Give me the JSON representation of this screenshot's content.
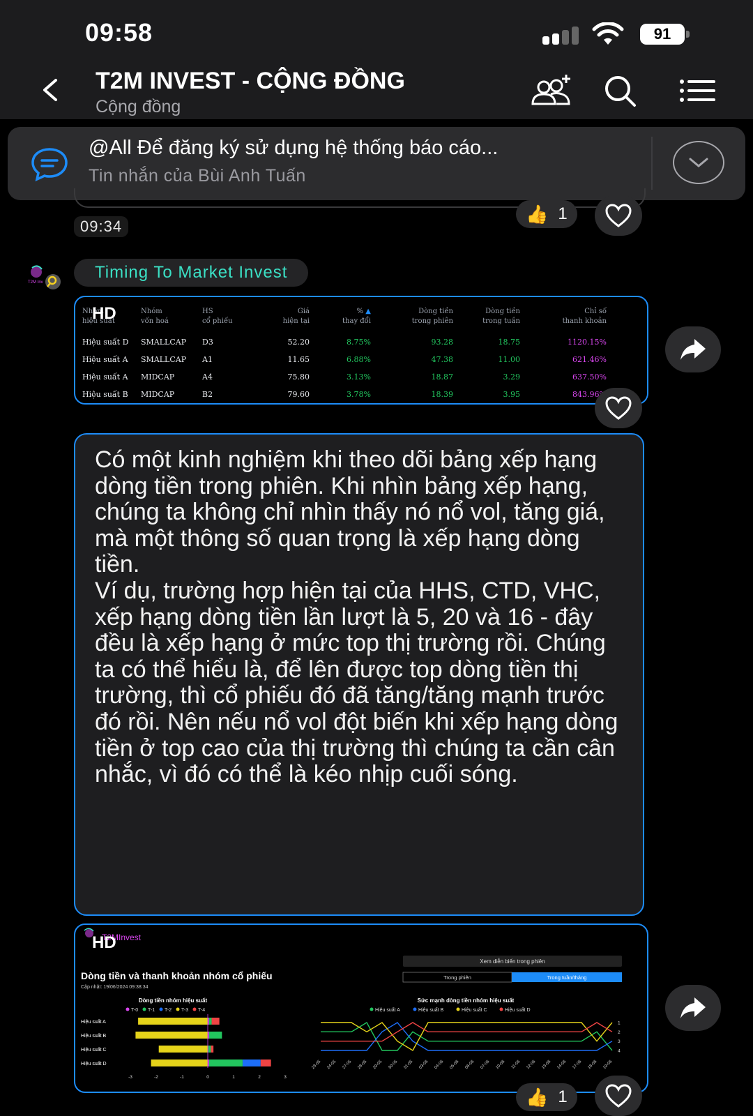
{
  "status_bar": {
    "time": "09:58",
    "battery": "91"
  },
  "header": {
    "title": "T2M INVEST - CỘNG ĐỒNG",
    "subtitle": "Cộng đồng"
  },
  "pinned": {
    "text": "@All Để đăng ký sử dụng hệ thống báo cáo...",
    "sender": "Tin nhắn của Bùi Anh Tuấn"
  },
  "messages": {
    "time_1": "09:34",
    "reaction_1": {
      "emoji": "thumbs-up",
      "count": "1"
    },
    "sender_name": "Timing To Market Invest",
    "hd_label": "HD",
    "table": {
      "headers": [
        [
          "Nhóm",
          "hiệu suất"
        ],
        [
          "Nhóm",
          "vốn hoá"
        ],
        [
          "HS",
          "cổ phiếu"
        ],
        [
          "Giá",
          "hiện tại"
        ],
        [
          "%",
          "thay đổi"
        ],
        [
          "Dòng tiền",
          "trong phiên"
        ],
        [
          "Dòng tiền",
          "trong tuần"
        ],
        [
          "Chỉ số",
          "thanh khoản"
        ]
      ],
      "rows": [
        [
          "Hiệu suất D",
          "SMALLCAP",
          "D3",
          "52.20",
          "8.75%",
          "93.28",
          "18.75",
          "1120.15%"
        ],
        [
          "Hiệu suất A",
          "SMALLCAP",
          "A1",
          "11.65",
          "6.88%",
          "47.38",
          "11.00",
          "621.46%"
        ],
        [
          "Hiệu suất A",
          "MIDCAP",
          "A4",
          "75.80",
          "3.13%",
          "18.87",
          "3.29",
          "637.50%"
        ],
        [
          "Hiệu suất B",
          "MIDCAP",
          "B2",
          "79.60",
          "3.78%",
          "18.39",
          "3.95",
          "843.96%"
        ]
      ]
    },
    "text_body": "Có một kinh nghiệm khi theo dõi bảng xếp hạng dòng tiền trong phiên. Khi nhìn bảng xếp hạng, chúng ta không chỉ nhìn thấy nó nổ vol, tăng giá, mà một thông số quan trọng là xếp hạng dòng tiền.\nVí dụ, trường hợp hiện tại của HHS, CTD, VHC, xếp hạng dòng tiền lần lượt là 5, 20 và 16 - đây đều là xếp hạng ở mức top thị trường rồi. Chúng ta có thể hiểu là, để lên được top dòng tiền thị trường, thì cổ phiếu đó đã tăng/tăng mạnh trước đó rồi. Nên nếu nổ vol đột biến khi xếp hạng dòng tiền ở top cao của thị trường thì chúng ta cần cân nhắc, vì đó có thể là kéo nhịp cuối sóng.",
    "reaction_2": {
      "emoji": "thumbs-up",
      "count": "1"
    }
  },
  "chart_image": {
    "brand": "T2MInvest",
    "title": "Dòng tiền và thanh khoản nhóm cổ phiếu",
    "updated": "Cập nhật: 19/06/2024 09:38:34",
    "toggle_label": "Xem diễn biến trong phiên",
    "tab_1": "Trong phiên",
    "tab_2": "Trong tuần/tháng",
    "colors": {
      "accent": "#1d8cf8",
      "teal": "#3be0c5"
    },
    "chart_data": [
      {
        "type": "bar",
        "title": "Dòng tiền nhóm hiệu suất",
        "categories": [
          "Hiệu suất A",
          "Hiệu suất B",
          "Hiệu suất C",
          "Hiệu suất D"
        ],
        "xlim": [
          -3,
          3
        ],
        "x_ticks": [
          "-3",
          "-2",
          "-1",
          "0",
          "1",
          "2",
          "3"
        ],
        "series": [
          {
            "name": "T-0",
            "color": "#d946ef",
            "values": [
              0.05,
              0.05,
              0.02,
              0.05
            ]
          },
          {
            "name": "T-1",
            "color": "#22c55e",
            "values": [
              0.1,
              0.5,
              0.1,
              1.3
            ]
          },
          {
            "name": "T-2",
            "color": "#1d6ef8",
            "values": [
              0.0,
              0.0,
              0.0,
              0.7
            ]
          },
          {
            "name": "T-3",
            "color": "#e5d31a",
            "values": [
              -2.7,
              -2.8,
              -1.9,
              -2.2
            ]
          },
          {
            "name": "T-4",
            "color": "#ef4444",
            "values": [
              0.3,
              0.0,
              0.1,
              0.4
            ]
          }
        ]
      },
      {
        "type": "line",
        "title": "Sức mạnh dòng tiền nhóm hiệu suất",
        "x": [
          "23-05",
          "24-05",
          "27-05",
          "28-05",
          "29-05",
          "30-05",
          "31-05",
          "03-06",
          "04-06",
          "05-06",
          "06-06",
          "07-06",
          "10-06",
          "11-06",
          "12-06",
          "13-06",
          "14-06",
          "17-06",
          "18-06",
          "19-06"
        ],
        "y_ticks": [
          "1",
          "2",
          "3",
          "4"
        ],
        "ylim": [
          1,
          4
        ],
        "series": [
          {
            "name": "Hiệu suất A",
            "color": "#22c55e",
            "values": [
              2,
              2,
              2,
              1,
              4,
              4,
              2,
              3,
              3,
              3,
              3,
              3,
              3,
              3,
              3,
              3,
              3,
              3,
              2,
              4
            ]
          },
          {
            "name": "Hiệu suất B",
            "color": "#1d6ef8",
            "values": [
              4,
              4,
              4,
              4,
              2,
              1,
              3,
              4,
              4,
              4,
              4,
              4,
              4,
              4,
              4,
              4,
              4,
              4,
              4,
              3
            ]
          },
          {
            "name": "Hiệu suất C",
            "color": "#e5d31a",
            "values": [
              1,
              1,
              1,
              2,
              1,
              3,
              4,
              1,
              1,
              1,
              1,
              1,
              1,
              1,
              1,
              1,
              1,
              1,
              3,
              1
            ]
          },
          {
            "name": "Hiệu suất D",
            "color": "#ef4444",
            "values": [
              3,
              3,
              3,
              3,
              3,
              2,
              1,
              2,
              2,
              2,
              2,
              2,
              2,
              2,
              2,
              2,
              2,
              2,
              1,
              2
            ]
          }
        ]
      }
    ]
  }
}
